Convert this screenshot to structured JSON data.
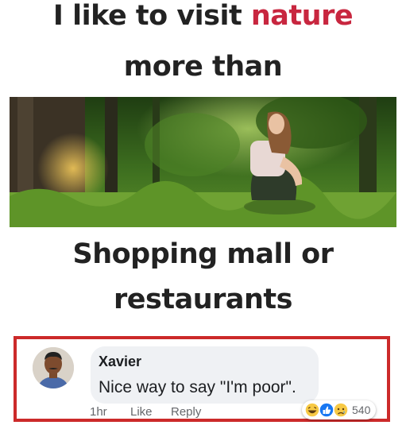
{
  "meme": {
    "line1_prefix": "I like to visit ",
    "line1_accent": "nature",
    "line2": "more than",
    "line3": "Shopping mall or",
    "line4": "restaurants",
    "accent_color": "#c8263f"
  },
  "comment": {
    "author": "Xavier",
    "text": "Nice way to say \"I'm poor\".",
    "time": "1hr",
    "like_label": "Like",
    "reply_label": "Reply",
    "reactions": [
      "laugh-emoji-icon",
      "thumbs-up-icon",
      "sad-emoji-icon"
    ],
    "reaction_count": "540",
    "highlight_color": "#cc2a2a"
  }
}
